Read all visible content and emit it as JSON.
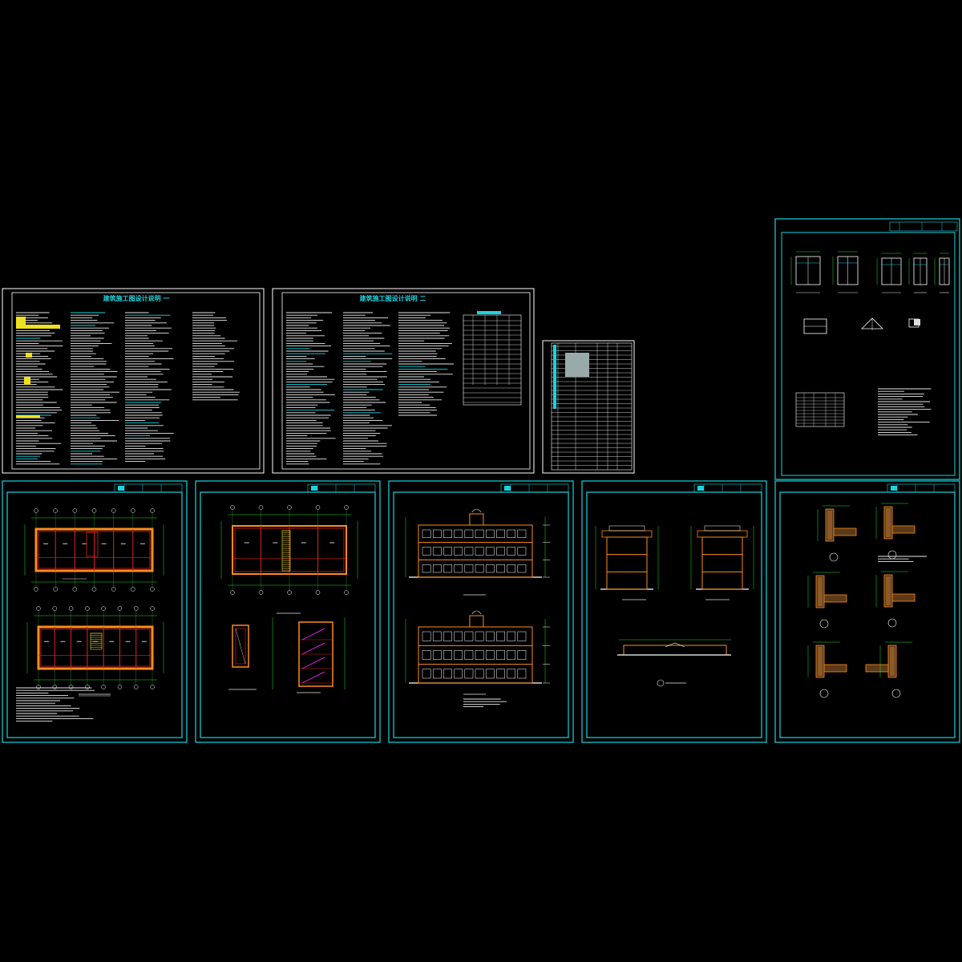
{
  "window": {
    "title": ""
  },
  "colors": {
    "background": "#000000",
    "frame": "#19d4e0",
    "text_white": "#e8e8e8",
    "wall_red": "#e02020",
    "wall_orange": "#ff8c1a",
    "dim_green": "#22e022",
    "accent_yellow": "#f0e020",
    "accent_magenta": "#e020e0"
  },
  "sheets": {
    "design_notes_1": {
      "title": "建筑施工图设计说明 一"
    },
    "design_notes_2": {
      "title": "建筑施工图设计说明 二"
    },
    "drawing_index": {
      "title": ""
    },
    "door_window_details": {
      "title": ""
    },
    "floor_plans": {
      "title": ""
    },
    "roof_stair_plans": {
      "title": ""
    },
    "elevations": {
      "title": ""
    },
    "side_elevations": {
      "title": ""
    },
    "wall_details": {
      "title": ""
    }
  }
}
